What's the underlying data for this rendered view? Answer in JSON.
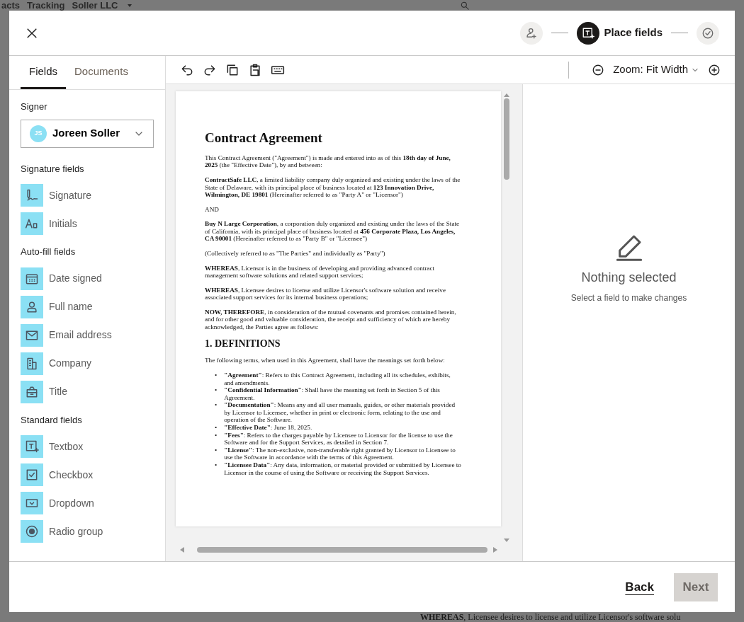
{
  "backdrop": {
    "header_texts": [
      "acts",
      "Tracking",
      "Soller LLC"
    ],
    "footer_text": "**WHEREAS**, Licensee desires to license and utilize Licensor's software solu"
  },
  "dialog": {
    "steps": [
      {
        "selected": false
      },
      {
        "selected": true,
        "label": "Place fields"
      },
      {
        "selected": false
      }
    ],
    "tabs": [
      {
        "label": "Fields",
        "selected": true
      },
      {
        "label": "Documents",
        "selected": false
      }
    ],
    "signer": {
      "label": "Signer",
      "initials": "JS",
      "name": "Joreen Soller"
    },
    "field_groups": [
      {
        "title": "Signature fields",
        "items": [
          {
            "label": "Signature"
          },
          {
            "label": "Initials"
          }
        ]
      },
      {
        "title": "Auto-fill fields",
        "items": [
          {
            "label": "Date signed"
          },
          {
            "label": "Full name"
          },
          {
            "label": "Email address"
          },
          {
            "label": "Company"
          },
          {
            "label": "Title"
          }
        ]
      },
      {
        "title": "Standard fields",
        "items": [
          {
            "label": "Textbox"
          },
          {
            "label": "Checkbox"
          },
          {
            "label": "Dropdown"
          },
          {
            "label": "Radio group"
          }
        ]
      }
    ],
    "zoom": {
      "label": "Zoom: Fit Width"
    },
    "document": {
      "title": "Contract Agreement",
      "paragraphs": [
        "This Contract Agreement (\"Agreement\") is made and entered into as of this **18th day of June, 2025** (the \"Effective Date\"), by and between:",
        "**ContractSafe LLC**, a limited liability company duly organized and existing under the laws of the State of Delaware, with its principal place of business located at **123 Innovation Drive, Wilmington, DE 19801** (Hereinafter referred to as \"Party A\" or \"Licensor\")",
        "AND",
        "**Buy N Large Corporation**, a corporation duly organized and existing under the laws of the State of California, with its principal place of business located at **456 Corporate Plaza, Los Angeles, CA 90001** (Hereinafter referred to as \"Party B\" or \"Licensee\")",
        "(Collectively referred to as \"The Parties\" and individually as \"Party\")",
        "**WHEREAS**, Licensor is in the business of developing and providing advanced contract management software solutions and related support services;",
        "**WHEREAS**, Licensee desires to license and utilize Licensor's software solution and receive associated support services for its internal business operations;",
        "**NOW, THEREFORE**, in consideration of the mutual covenants and promises contained herein, and for other good and valuable consideration, the receipt and sufficiency of which are hereby acknowledged, the Parties agree as follows:"
      ],
      "heading": "1. DEFINITIONS",
      "intro": "The following terms, when used in this Agreement, shall have the meanings set forth below:",
      "bullets": [
        {
          "marker": "•",
          "text": "**\"Agreement\"**: Refers to this Contract Agreement, including all its schedules, exhibits, and amendments."
        },
        {
          "marker": "•",
          "text": "**\"Confidential Information\"**: Shall have the meaning set forth in Section 5 of this Agreement."
        },
        {
          "marker": "•",
          "text": "**\"Documentation\"**: Means any and all user manuals, guides, or other materials provided by Licensor to Licensee, whether in print or electronic form, relating to the use and operation of the Software."
        },
        {
          "marker": "•",
          "text": "**\"Effective Date\"**: June 18, 2025."
        },
        {
          "marker": "•",
          "text": "**\"Fees\"**: Refers to the charges payable by Licensee to Licensor for the license to use the Software and for the Support Services, as detailed in Section 7."
        },
        {
          "marker": "•",
          "text": "**\"License\"**: The non-exclusive, non-transferable right granted by Licensor to Licensee to use the Software in accordance with the terms of this Agreement."
        },
        {
          "marker": "•",
          "text": "**\"Licensee Data\"**: Any data, information, or material provided or submitted by Licensee to Licensor in the course of using the Software or receiving the Support Services."
        }
      ]
    },
    "empty_state": {
      "title": "Nothing selected",
      "hint": "Select a field to make changes"
    },
    "footer": {
      "back": {
        "label": "Back"
      },
      "next": {
        "label": "Next",
        "disabled": true
      }
    }
  }
}
